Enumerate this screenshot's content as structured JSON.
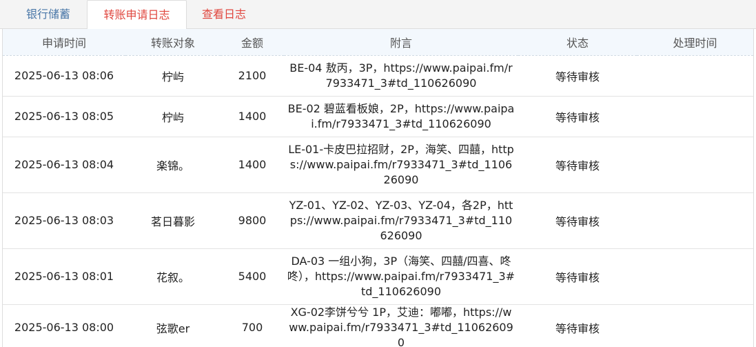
{
  "tabs": [
    {
      "label": "银行储蓄",
      "color": "#4a77a8"
    },
    {
      "label": "转账申请日志",
      "color": "#e0463e"
    },
    {
      "label": "查看日志",
      "color": "#e0463e"
    }
  ],
  "table": {
    "headers": [
      "申请时间",
      "转账对象",
      "金额",
      "附言",
      "状态",
      "处理时间"
    ],
    "rows": [
      {
        "time": "2025-06-13 08:06",
        "target": "柠屿",
        "amount": "2100",
        "note": "BE-04 敖丙，3P，https://www.paipai.fm/r7933471_3#td_110626090",
        "status": "等待审核",
        "processed": ""
      },
      {
        "time": "2025-06-13 08:05",
        "target": "柠屿",
        "amount": "1400",
        "note": "BE-02 碧蓝看板娘，2P，https://www.paipai.fm/r7933471_3#td_110626090",
        "status": "等待审核",
        "processed": ""
      },
      {
        "time": "2025-06-13 08:04",
        "target": "楽锦。",
        "amount": "1400",
        "note": "LE-01-卡皮巴拉招财，2P，海笑、四囍，https://www.paipai.fm/r7933471_3#td_110626090",
        "status": "等待审核",
        "processed": ""
      },
      {
        "time": "2025-06-13 08:03",
        "target": "茗日暮影",
        "amount": "9800",
        "note": "YZ-01、YZ-02、YZ-03、YZ-04，各2P，https://www.paipai.fm/r7933471_3#td_110626090",
        "status": "等待审核",
        "processed": ""
      },
      {
        "time": "2025-06-13 08:01",
        "target": "花叙。",
        "amount": "5400",
        "note": "DA-03 一组小狗，3P（海笑、四囍/四喜、咚咚），https://www.paipai.fm/r7933471_3#td_110626090",
        "status": "等待审核",
        "processed": ""
      },
      {
        "time": "2025-06-13 08:00",
        "target": "弦歌er",
        "amount": "700",
        "note": "XG-02李饼兮兮 1P，艾迪：嘟嘟，https://www.paipai.fm/r7933471_3#td_110626090",
        "status": "等待审核",
        "processed": ""
      }
    ]
  }
}
